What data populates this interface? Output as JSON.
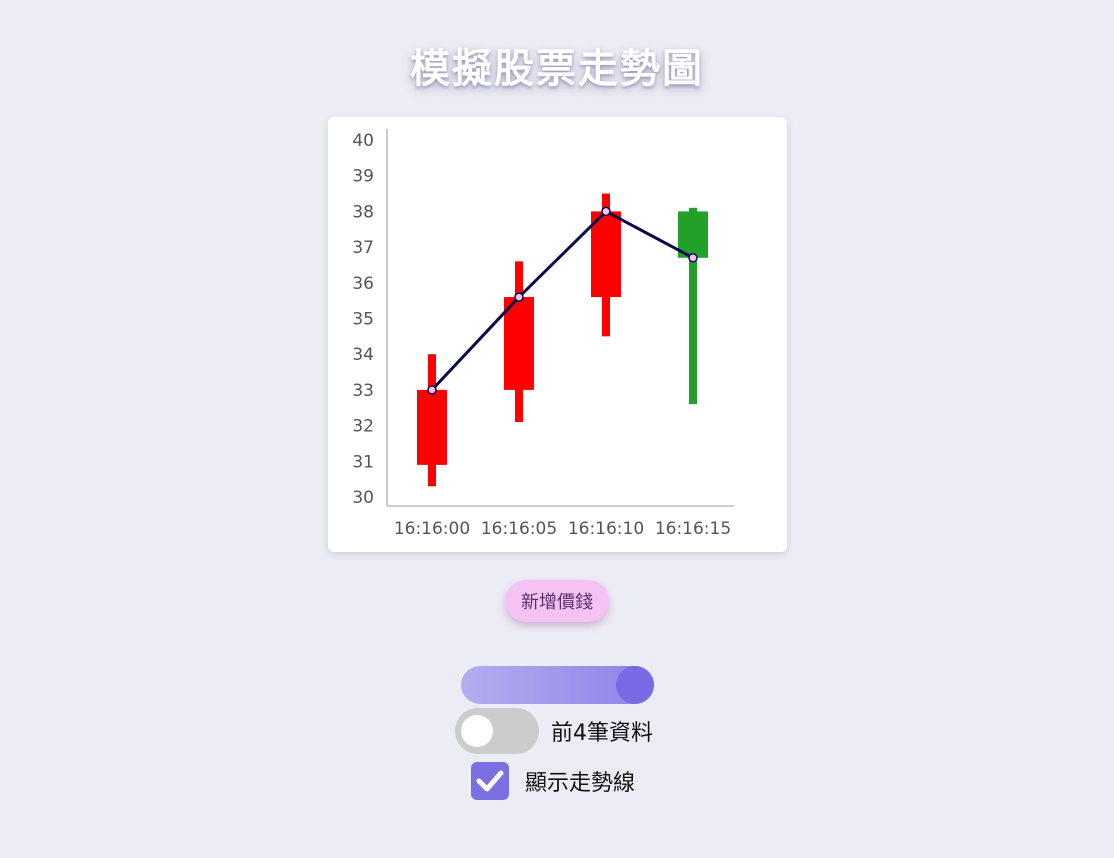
{
  "page": {
    "title": "模擬股票走勢圖"
  },
  "controls": {
    "add_button_label": "新增價錢",
    "slider_value_fraction": 1.0,
    "toggle_label": "前4筆資料",
    "toggle_on": false,
    "checkbox_label": "顯示走勢線",
    "checkbox_checked": true
  },
  "colors": {
    "rise": "#ff0000",
    "fall": "#22a02a",
    "trend_line": "#0b0b4a",
    "accent": "#7b6fe2"
  },
  "chart_data": {
    "type": "candlestick",
    "categories": [
      "16:16:00",
      "16:16:05",
      "16:16:10",
      "16:16:15"
    ],
    "candles": [
      {
        "time": "16:16:00",
        "open": 30.9,
        "close": 33.0,
        "low": 30.3,
        "high": 34.0
      },
      {
        "time": "16:16:05",
        "open": 33.0,
        "close": 35.6,
        "low": 32.1,
        "high": 36.6
      },
      {
        "time": "16:16:10",
        "open": 35.6,
        "close": 38.0,
        "low": 34.5,
        "high": 38.5
      },
      {
        "time": "16:16:15",
        "open": 38.0,
        "close": 36.7,
        "low": 32.6,
        "high": 38.1
      }
    ],
    "trend_line": [
      33.0,
      35.6,
      38.0,
      36.7
    ],
    "y_ticks": [
      "30",
      "31",
      "32",
      "33",
      "34",
      "35",
      "36",
      "37",
      "38",
      "39",
      "40"
    ],
    "ylim": [
      30,
      40
    ],
    "grid": false
  }
}
